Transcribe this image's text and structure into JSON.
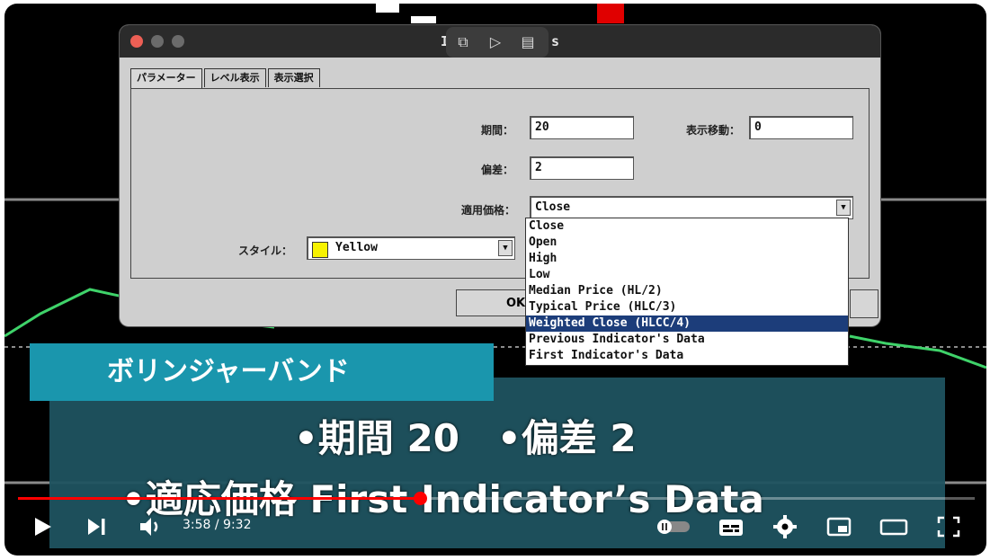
{
  "dialog": {
    "title_fragment_left": "I",
    "title_fragment_right": "s",
    "tabs": [
      "パラメーター",
      "レベル表示",
      "表示選択"
    ],
    "labels": {
      "period": "期間：",
      "shift": "表示移動：",
      "deviation": "偏差：",
      "apply_price": "適用価格：",
      "style": "スタイル："
    },
    "fields": {
      "period": "20",
      "shift": "0",
      "deviation": "2",
      "apply_price": "Close",
      "style": "Yellow"
    },
    "apply_price_options": [
      "Close",
      "Open",
      "High",
      "Low",
      "Median Price (HL/2)",
      "Typical Price (HLC/3)",
      "Weighted Close (HLCC/4)",
      "Previous Indicator's Data",
      "First Indicator's Data"
    ],
    "selected_option_index": 6,
    "ok_label": "OK"
  },
  "banner": {
    "tag": "ボリンジャーバンド",
    "line1": "•期間 20　•偏差 2",
    "line2": "•適応価格 First Indicator’s Data"
  },
  "player": {
    "time": "3:58 / 9:32",
    "progress": 0.42,
    "accent": "#ff0000"
  },
  "colors": {
    "banner_tag": "#1a96ad",
    "banner_dark": "#1f5360",
    "selection": "#1c3d7a"
  }
}
